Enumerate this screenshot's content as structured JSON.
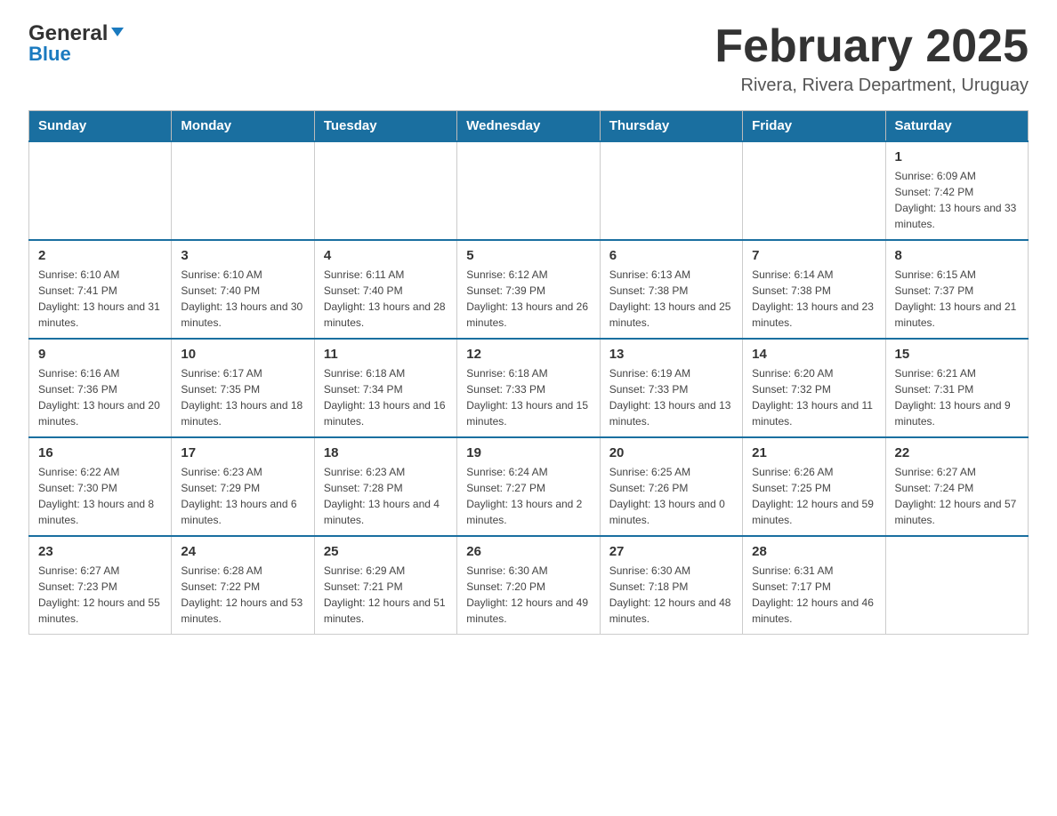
{
  "header": {
    "logo_general": "General",
    "logo_blue": "Blue",
    "title": "February 2025",
    "subtitle": "Rivera, Rivera Department, Uruguay"
  },
  "days_of_week": [
    "Sunday",
    "Monday",
    "Tuesday",
    "Wednesday",
    "Thursday",
    "Friday",
    "Saturday"
  ],
  "weeks": [
    [
      {
        "day": "",
        "sunrise": "",
        "sunset": "",
        "daylight": ""
      },
      {
        "day": "",
        "sunrise": "",
        "sunset": "",
        "daylight": ""
      },
      {
        "day": "",
        "sunrise": "",
        "sunset": "",
        "daylight": ""
      },
      {
        "day": "",
        "sunrise": "",
        "sunset": "",
        "daylight": ""
      },
      {
        "day": "",
        "sunrise": "",
        "sunset": "",
        "daylight": ""
      },
      {
        "day": "",
        "sunrise": "",
        "sunset": "",
        "daylight": ""
      },
      {
        "day": "1",
        "sunrise": "Sunrise: 6:09 AM",
        "sunset": "Sunset: 7:42 PM",
        "daylight": "Daylight: 13 hours and 33 minutes."
      }
    ],
    [
      {
        "day": "2",
        "sunrise": "Sunrise: 6:10 AM",
        "sunset": "Sunset: 7:41 PM",
        "daylight": "Daylight: 13 hours and 31 minutes."
      },
      {
        "day": "3",
        "sunrise": "Sunrise: 6:10 AM",
        "sunset": "Sunset: 7:40 PM",
        "daylight": "Daylight: 13 hours and 30 minutes."
      },
      {
        "day": "4",
        "sunrise": "Sunrise: 6:11 AM",
        "sunset": "Sunset: 7:40 PM",
        "daylight": "Daylight: 13 hours and 28 minutes."
      },
      {
        "day": "5",
        "sunrise": "Sunrise: 6:12 AM",
        "sunset": "Sunset: 7:39 PM",
        "daylight": "Daylight: 13 hours and 26 minutes."
      },
      {
        "day": "6",
        "sunrise": "Sunrise: 6:13 AM",
        "sunset": "Sunset: 7:38 PM",
        "daylight": "Daylight: 13 hours and 25 minutes."
      },
      {
        "day": "7",
        "sunrise": "Sunrise: 6:14 AM",
        "sunset": "Sunset: 7:38 PM",
        "daylight": "Daylight: 13 hours and 23 minutes."
      },
      {
        "day": "8",
        "sunrise": "Sunrise: 6:15 AM",
        "sunset": "Sunset: 7:37 PM",
        "daylight": "Daylight: 13 hours and 21 minutes."
      }
    ],
    [
      {
        "day": "9",
        "sunrise": "Sunrise: 6:16 AM",
        "sunset": "Sunset: 7:36 PM",
        "daylight": "Daylight: 13 hours and 20 minutes."
      },
      {
        "day": "10",
        "sunrise": "Sunrise: 6:17 AM",
        "sunset": "Sunset: 7:35 PM",
        "daylight": "Daylight: 13 hours and 18 minutes."
      },
      {
        "day": "11",
        "sunrise": "Sunrise: 6:18 AM",
        "sunset": "Sunset: 7:34 PM",
        "daylight": "Daylight: 13 hours and 16 minutes."
      },
      {
        "day": "12",
        "sunrise": "Sunrise: 6:18 AM",
        "sunset": "Sunset: 7:33 PM",
        "daylight": "Daylight: 13 hours and 15 minutes."
      },
      {
        "day": "13",
        "sunrise": "Sunrise: 6:19 AM",
        "sunset": "Sunset: 7:33 PM",
        "daylight": "Daylight: 13 hours and 13 minutes."
      },
      {
        "day": "14",
        "sunrise": "Sunrise: 6:20 AM",
        "sunset": "Sunset: 7:32 PM",
        "daylight": "Daylight: 13 hours and 11 minutes."
      },
      {
        "day": "15",
        "sunrise": "Sunrise: 6:21 AM",
        "sunset": "Sunset: 7:31 PM",
        "daylight": "Daylight: 13 hours and 9 minutes."
      }
    ],
    [
      {
        "day": "16",
        "sunrise": "Sunrise: 6:22 AM",
        "sunset": "Sunset: 7:30 PM",
        "daylight": "Daylight: 13 hours and 8 minutes."
      },
      {
        "day": "17",
        "sunrise": "Sunrise: 6:23 AM",
        "sunset": "Sunset: 7:29 PM",
        "daylight": "Daylight: 13 hours and 6 minutes."
      },
      {
        "day": "18",
        "sunrise": "Sunrise: 6:23 AM",
        "sunset": "Sunset: 7:28 PM",
        "daylight": "Daylight: 13 hours and 4 minutes."
      },
      {
        "day": "19",
        "sunrise": "Sunrise: 6:24 AM",
        "sunset": "Sunset: 7:27 PM",
        "daylight": "Daylight: 13 hours and 2 minutes."
      },
      {
        "day": "20",
        "sunrise": "Sunrise: 6:25 AM",
        "sunset": "Sunset: 7:26 PM",
        "daylight": "Daylight: 13 hours and 0 minutes."
      },
      {
        "day": "21",
        "sunrise": "Sunrise: 6:26 AM",
        "sunset": "Sunset: 7:25 PM",
        "daylight": "Daylight: 12 hours and 59 minutes."
      },
      {
        "day": "22",
        "sunrise": "Sunrise: 6:27 AM",
        "sunset": "Sunset: 7:24 PM",
        "daylight": "Daylight: 12 hours and 57 minutes."
      }
    ],
    [
      {
        "day": "23",
        "sunrise": "Sunrise: 6:27 AM",
        "sunset": "Sunset: 7:23 PM",
        "daylight": "Daylight: 12 hours and 55 minutes."
      },
      {
        "day": "24",
        "sunrise": "Sunrise: 6:28 AM",
        "sunset": "Sunset: 7:22 PM",
        "daylight": "Daylight: 12 hours and 53 minutes."
      },
      {
        "day": "25",
        "sunrise": "Sunrise: 6:29 AM",
        "sunset": "Sunset: 7:21 PM",
        "daylight": "Daylight: 12 hours and 51 minutes."
      },
      {
        "day": "26",
        "sunrise": "Sunrise: 6:30 AM",
        "sunset": "Sunset: 7:20 PM",
        "daylight": "Daylight: 12 hours and 49 minutes."
      },
      {
        "day": "27",
        "sunrise": "Sunrise: 6:30 AM",
        "sunset": "Sunset: 7:18 PM",
        "daylight": "Daylight: 12 hours and 48 minutes."
      },
      {
        "day": "28",
        "sunrise": "Sunrise: 6:31 AM",
        "sunset": "Sunset: 7:17 PM",
        "daylight": "Daylight: 12 hours and 46 minutes."
      },
      {
        "day": "",
        "sunrise": "",
        "sunset": "",
        "daylight": ""
      }
    ]
  ]
}
